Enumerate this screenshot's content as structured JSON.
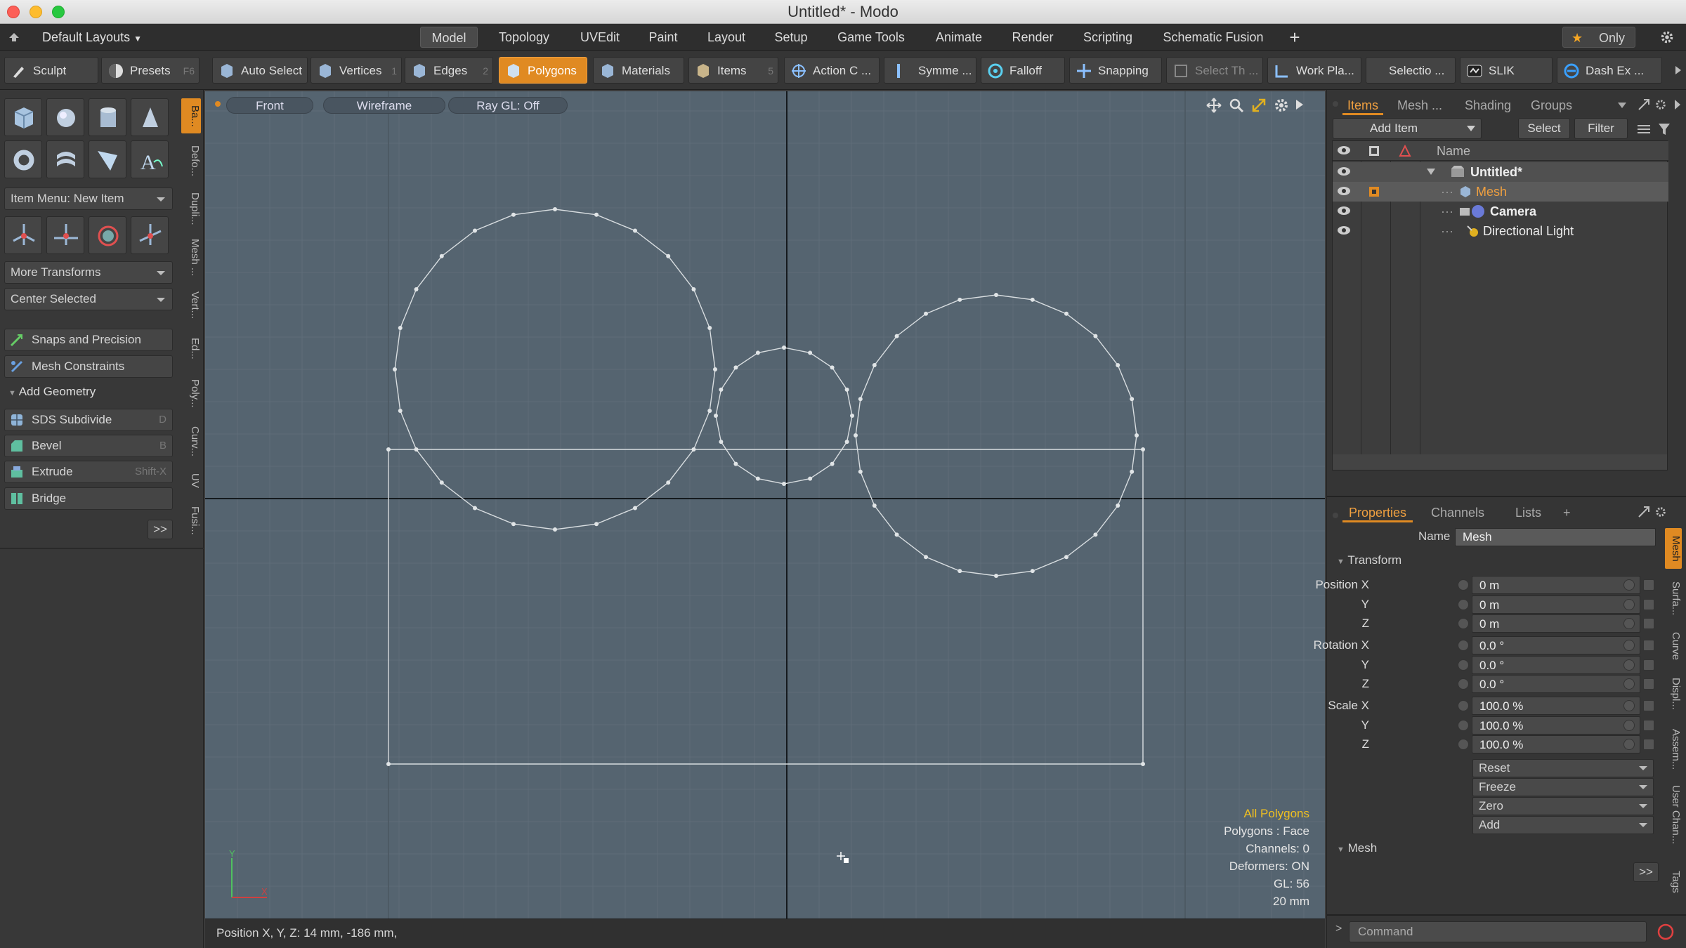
{
  "window": {
    "title": "Untitled* - Modo"
  },
  "menubar": {
    "layouts": "Default Layouts",
    "tabs": [
      "Model",
      "Topology",
      "UVEdit",
      "Paint",
      "Layout",
      "Setup",
      "Game Tools",
      "Animate",
      "Render",
      "Scripting",
      "Schematic Fusion"
    ],
    "add": "+",
    "only": "Only",
    "active_tab": "Model"
  },
  "toolbar": {
    "sculpt": "Sculpt",
    "presets": "Presets",
    "presets_key": "F6",
    "auto_select": "Auto Select",
    "vertices": "Vertices",
    "vertices_key": "1",
    "edges": "Edges",
    "edges_key": "2",
    "polygons": "Polygons",
    "materials": "Materials",
    "items": "Items",
    "items_key": "5",
    "action_center": "Action C ...",
    "symmetry": "Symme ...",
    "falloff": "Falloff",
    "snapping": "Snapping",
    "select_through": "Select Th ...",
    "work_plane": "Work Pla...",
    "selection": "Selectio ...",
    "slik": "SLIK",
    "dash_ex": "Dash Ex ..."
  },
  "leftpanel": {
    "item_menu": "Item Menu: New Item",
    "more_transforms": "More Transforms",
    "center_selected": "Center Selected",
    "snaps": "Snaps and Precision",
    "mesh_constraints": "Mesh Constraints",
    "add_geometry": "Add Geometry",
    "sds": "SDS Subdivide",
    "sds_key": "D",
    "bevel": "Bevel",
    "bevel_key": "B",
    "extrude": "Extrude",
    "extrude_key": "Shift-X",
    "bridge": "Bridge",
    "more": ">>",
    "vtabs": [
      "Ba...",
      "Defo...",
      "Dupli...",
      "Mesh ...",
      "Vert...",
      "Ed...",
      "Poly...",
      "Curv...",
      "UV",
      "Fusi..."
    ]
  },
  "viewport": {
    "view": "Front",
    "shading": "Wireframe",
    "raygl": "Ray GL: Off",
    "stats": {
      "title": "All Polygons",
      "lines": [
        "Polygons : Face",
        "Channels: 0",
        "Deformers: ON",
        "GL: 56",
        "20 mm"
      ]
    },
    "axis_y": "Y",
    "axis_x": "X"
  },
  "statusbar": {
    "text": "Position X, Y, Z:  14 mm, -186 mm,"
  },
  "rightpanel": {
    "tabs_top": [
      "Items",
      "Mesh ...",
      "Shading",
      "Groups"
    ],
    "add_item": "Add Item",
    "select": "Select",
    "filter": "Filter",
    "name_header": "Name",
    "items": [
      {
        "name": "Untitled*",
        "indent": 0
      },
      {
        "name": "Mesh",
        "indent": 1
      },
      {
        "name": "Camera",
        "indent": 1
      },
      {
        "name": "Directional Light",
        "indent": 1
      }
    ],
    "tabs_bottom": [
      "Properties",
      "Channels",
      "Lists",
      "+"
    ],
    "name_label": "Name",
    "name_value": "Mesh",
    "transform": "Transform",
    "props": [
      {
        "label": "Position X",
        "value": "0 m"
      },
      {
        "label": "Y",
        "value": "0 m"
      },
      {
        "label": "Z",
        "value": "0 m"
      },
      {
        "label": "Rotation X",
        "value": "0.0 °"
      },
      {
        "label": "Y",
        "value": "0.0 °"
      },
      {
        "label": "Z",
        "value": "0.0 °"
      },
      {
        "label": "Scale X",
        "value": "100.0 %"
      },
      {
        "label": "Y",
        "value": "100.0 %"
      },
      {
        "label": "Z",
        "value": "100.0 %"
      }
    ],
    "dropdowns": [
      "Reset",
      "Freeze",
      "Zero",
      "Add"
    ],
    "mesh_section": "Mesh",
    "more": ">>",
    "side_tabs": [
      "Mesh",
      "Surfa...",
      "Curve",
      "Displ...",
      "Assem...",
      "User Chan...",
      "Tags"
    ],
    "command_placeholder": "Command"
  },
  "colors": {
    "accent": "#e08a22",
    "viewport": "#556470",
    "wire": "#d8dde0"
  }
}
